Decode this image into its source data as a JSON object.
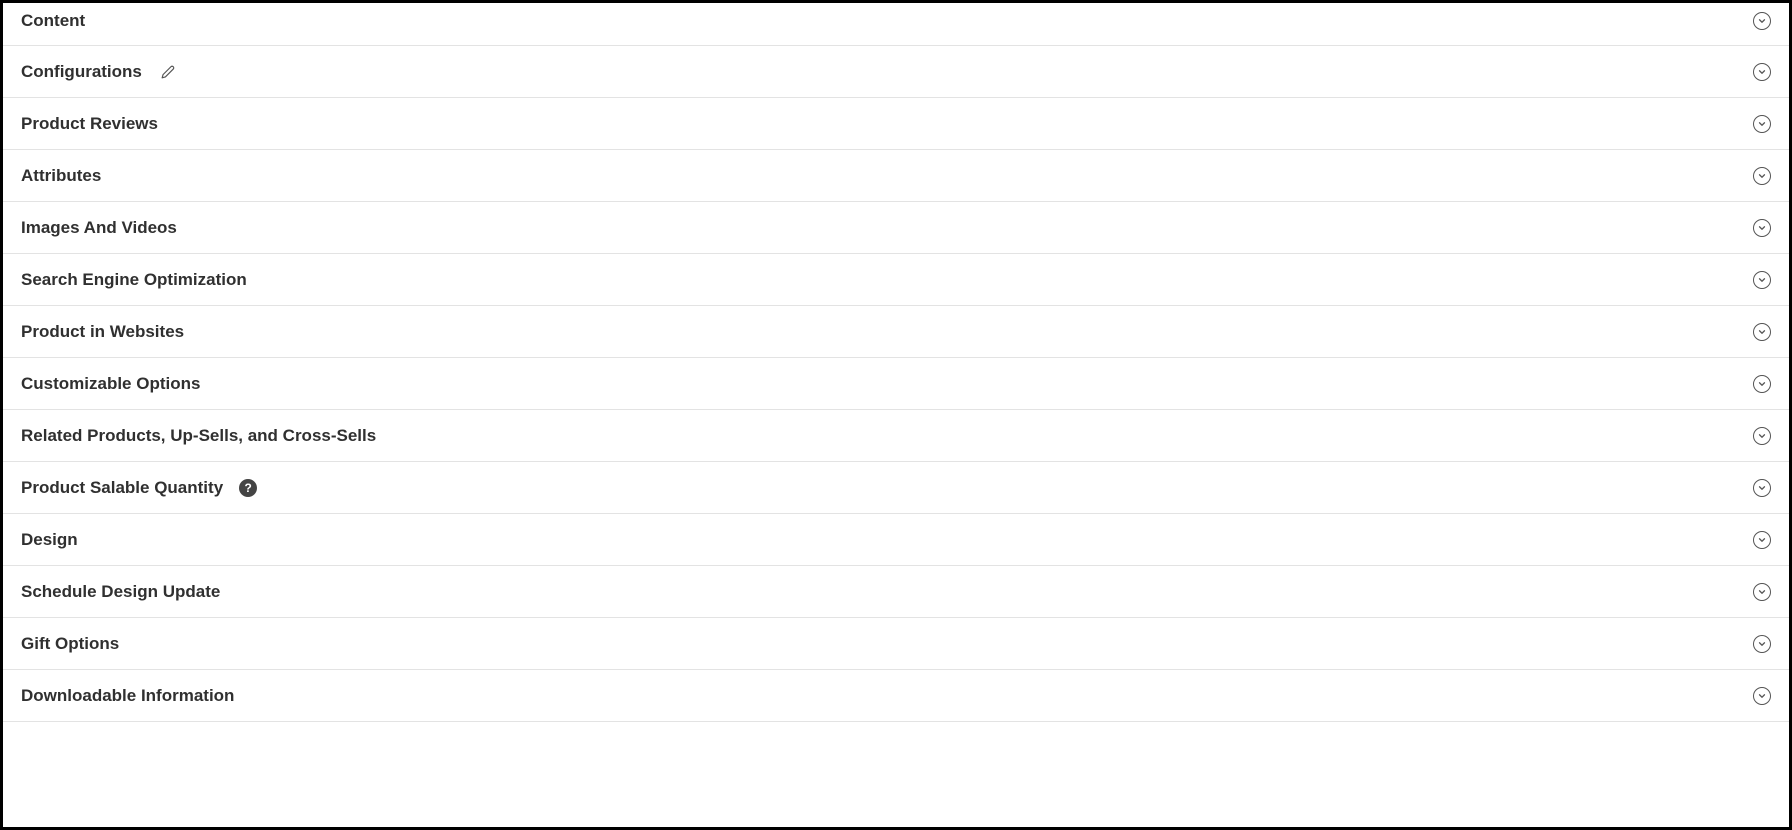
{
  "sections": [
    {
      "label": "Content",
      "hasEdit": false,
      "hasHelp": false
    },
    {
      "label": "Configurations",
      "hasEdit": true,
      "hasHelp": false
    },
    {
      "label": "Product Reviews",
      "hasEdit": false,
      "hasHelp": false
    },
    {
      "label": "Attributes",
      "hasEdit": false,
      "hasHelp": false
    },
    {
      "label": "Images And Videos",
      "hasEdit": false,
      "hasHelp": false
    },
    {
      "label": "Search Engine Optimization",
      "hasEdit": false,
      "hasHelp": false
    },
    {
      "label": "Product in Websites",
      "hasEdit": false,
      "hasHelp": false
    },
    {
      "label": "Customizable Options",
      "hasEdit": false,
      "hasHelp": false
    },
    {
      "label": "Related Products, Up-Sells, and Cross-Sells",
      "hasEdit": false,
      "hasHelp": false
    },
    {
      "label": "Product Salable Quantity",
      "hasEdit": false,
      "hasHelp": true
    },
    {
      "label": "Design",
      "hasEdit": false,
      "hasHelp": false
    },
    {
      "label": "Schedule Design Update",
      "hasEdit": false,
      "hasHelp": false
    },
    {
      "label": "Gift Options",
      "hasEdit": false,
      "hasHelp": false
    },
    {
      "label": "Downloadable Information",
      "hasEdit": false,
      "hasHelp": false
    }
  ]
}
